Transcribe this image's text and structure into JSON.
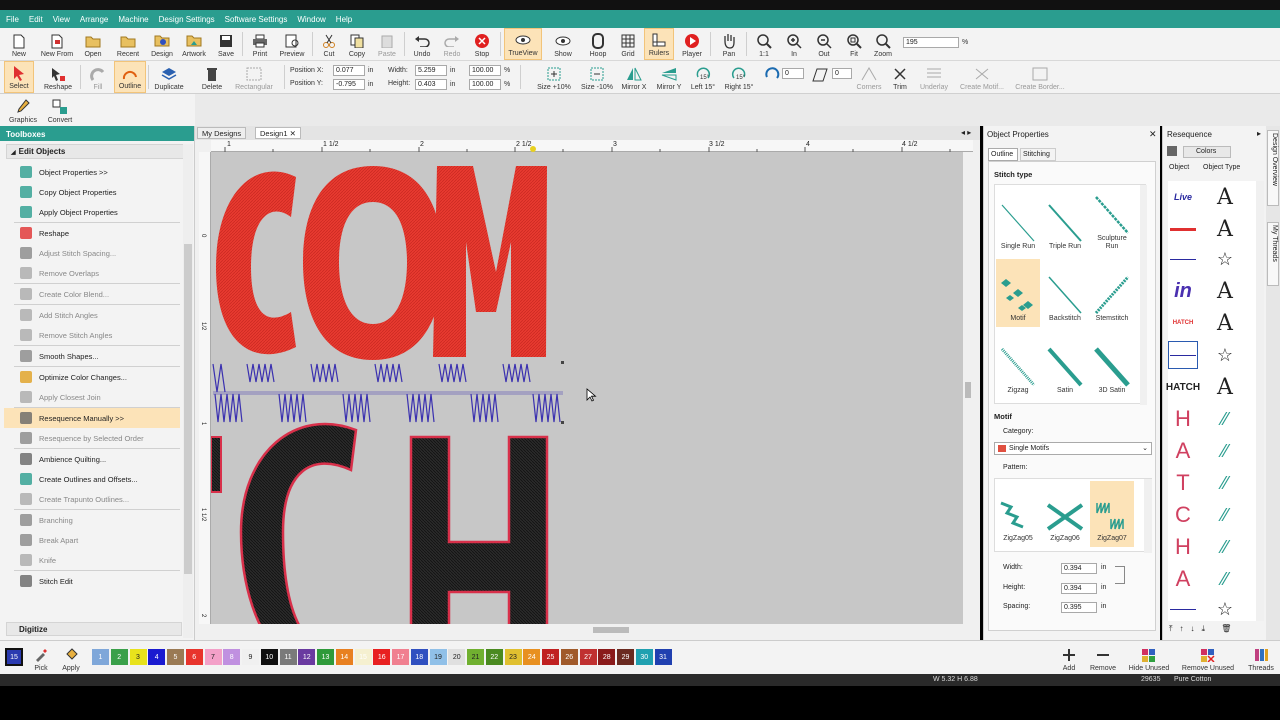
{
  "menu": [
    "File",
    "Edit",
    "View",
    "Arrange",
    "Machine",
    "Design Settings",
    "Software Settings",
    "Window",
    "Help"
  ],
  "toolbar1": {
    "buttons": [
      "New",
      "New From",
      "Open",
      "Recent",
      "Design",
      "Artwork",
      "Save",
      "Print",
      "Preview",
      "Cut",
      "Copy",
      "Paste",
      "Undo",
      "Redo",
      "Stop",
      "TrueView",
      "Show",
      "Hoop",
      "Grid",
      "Rulers",
      "Player",
      "Pan",
      "1:1",
      "In",
      "Out",
      "Fit",
      "Zoom"
    ],
    "zoom_value": "195",
    "zoom_unit": "%"
  },
  "toolbar2": {
    "buttons": [
      "Select",
      "Reshape",
      "Fill",
      "Outline",
      "Duplicate",
      "Delete",
      "Rectangular"
    ],
    "position_x_label": "Position X:",
    "position_x_value": "0.077",
    "position_y_label": "Position Y:",
    "position_y_value": "-0.795",
    "unit": "in",
    "width_label": "Width:",
    "width_value": "5.259",
    "height_label": "Height:",
    "height_value": "0.403",
    "pct_w": "100.00",
    "pct_h": "100.00",
    "pct_unit": "%",
    "right_buttons": [
      "Size +10%",
      "Size -10%",
      "Mirror X",
      "Mirror Y",
      "Left 15°",
      "Right 15°",
      "Corners",
      "Trim",
      "Underlay",
      "Create Motif...",
      "Create Border..."
    ],
    "rotate_value": "0",
    "skew_value": "0"
  },
  "toolbar3": {
    "buttons": [
      "Graphics",
      "Convert"
    ]
  },
  "left_panel": {
    "title": "Toolboxes",
    "section": "Edit Objects",
    "items": [
      {
        "label": "Object Properties >>",
        "dis": false
      },
      {
        "label": "Copy Object Properties",
        "dis": false
      },
      {
        "label": "Apply Object Properties",
        "dis": false
      },
      {
        "label": "Reshape",
        "dis": false
      },
      {
        "label": "Adjust Stitch Spacing...",
        "dis": true
      },
      {
        "label": "Remove Overlaps",
        "dis": true
      },
      {
        "label": "Create Color Blend...",
        "dis": true
      },
      {
        "label": "Add Stitch Angles",
        "dis": true
      },
      {
        "label": "Remove Stitch Angles",
        "dis": true
      },
      {
        "label": "Smooth Shapes...",
        "dis": false
      },
      {
        "label": "Optimize Color Changes...",
        "dis": false
      },
      {
        "label": "Apply Closest Join",
        "dis": true
      },
      {
        "label": "Resequence Manually >>",
        "dis": false
      },
      {
        "label": "Resequence by Selected Order",
        "dis": true
      },
      {
        "label": "Ambience Quilting...",
        "dis": false
      },
      {
        "label": "Create Outlines and Offsets...",
        "dis": false
      },
      {
        "label": "Create Trapunto Outlines...",
        "dis": true
      },
      {
        "label": "Branching",
        "dis": true
      },
      {
        "label": "Break Apart",
        "dis": true
      },
      {
        "label": "Knife",
        "dis": true
      },
      {
        "label": "Stitch Edit",
        "dis": false
      }
    ],
    "digitize": "Digitize"
  },
  "tabs": [
    "My Designs",
    "Design1"
  ],
  "ruler": {
    "top": [
      "1",
      "1 1/2",
      "2",
      "2 1/2",
      "3",
      "3 1/2",
      "4",
      "4 1/2"
    ],
    "left": [
      "0",
      "1/2",
      "1",
      "1 1/2",
      "2"
    ]
  },
  "object_properties": {
    "title": "Object Properties",
    "tabs": [
      "Outline",
      "Stitching"
    ],
    "stitch_type_label": "Stitch type",
    "stitch_types": [
      "Single Run",
      "Triple Run",
      "Sculpture Run",
      "Motif",
      "Backstitch",
      "Stemstitch",
      "Zigzag",
      "Satin",
      "3D Satin"
    ],
    "motif_label": "Motif",
    "category_label": "Category:",
    "category_value": "Single Motifs",
    "pattern_label": "Pattern:",
    "patterns": [
      "ZigZag05",
      "ZigZag06",
      "ZigZag07"
    ],
    "width_label": "Width:",
    "width_value": "0.394",
    "height_label": "Height:",
    "height_value": "0.394",
    "spacing_label": "Spacing:",
    "spacing_value": "0.395",
    "unit": "in"
  },
  "resequence": {
    "title": "Resequence",
    "colors_tab": "Colors",
    "col1": "Object",
    "col2": "Object Type",
    "thumbs": [
      "Live",
      "",
      "",
      "in",
      "HATCH",
      "",
      "HATCH",
      "H",
      "A",
      "T",
      "C",
      "H",
      "A",
      "",
      ""
    ]
  },
  "side_tabs": [
    "Design Overview",
    "My Threads"
  ],
  "palette": {
    "numbers": [
      "1",
      "2",
      "3",
      "4",
      "5",
      "6",
      "7",
      "8",
      "9",
      "10",
      "11",
      "12",
      "13",
      "14",
      "15",
      "16",
      "17",
      "18",
      "19",
      "20",
      "21",
      "22",
      "23",
      "24",
      "25",
      "26",
      "27",
      "28",
      "29",
      "30",
      "31"
    ],
    "colors": [
      "#7fa7d9",
      "#3aa04a",
      "#e8e21c",
      "#1a1ad0",
      "#9a7a54",
      "#e8342c",
      "#f3a0c8",
      "#c090e0",
      "#f0f0f0",
      "#101010",
      "#7a7a7a",
      "#6a3aa0",
      "#2f9a3a",
      "#e88020",
      "#f5f0d0",
      "#e82020",
      "#f08090",
      "#3050c0",
      "#90c0e8",
      "#e0e0e0",
      "#70b030",
      "#4a8a20",
      "#e0c030",
      "#e89020",
      "#c02020",
      "#a05a2a",
      "#c03030",
      "#8a1a1a",
      "#6a2a20",
      "#20a0b0",
      "#2040b0"
    ],
    "current_number": "15",
    "pick": "Pick",
    "apply": "Apply",
    "right_buttons": [
      "Add",
      "Remove",
      "Hide Unused",
      "Remove Unused",
      "Threads"
    ]
  },
  "status": {
    "size": "W 5.32 H 6.88",
    "stitches": "29635",
    "thread": "Pure Cotton"
  }
}
